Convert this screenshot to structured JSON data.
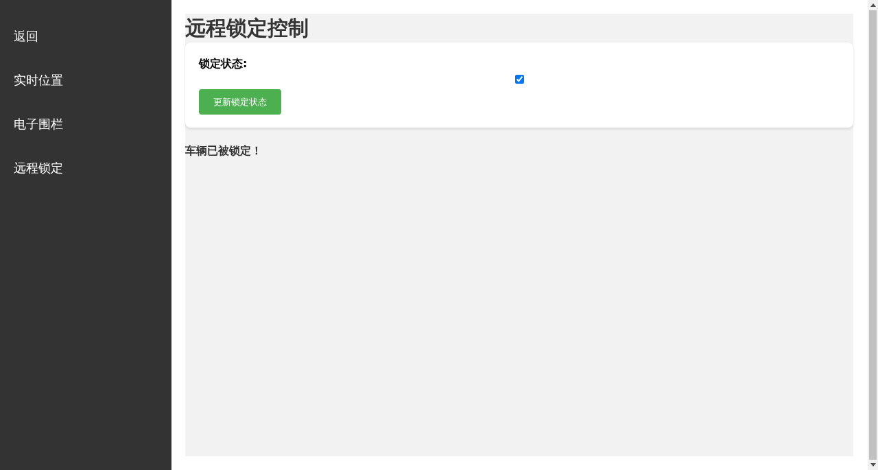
{
  "sidebar": {
    "items": [
      {
        "label": "返回",
        "selected": false
      },
      {
        "label": "实时位置",
        "selected": false
      },
      {
        "label": "电子围栏",
        "selected": false
      },
      {
        "label": "远程锁定",
        "selected": false
      }
    ]
  },
  "title": "远程锁定控制",
  "lock_form": {
    "label": "锁定状态:",
    "checked": true,
    "button": "更新锁定状态"
  },
  "message": "车辆已被锁定！"
}
